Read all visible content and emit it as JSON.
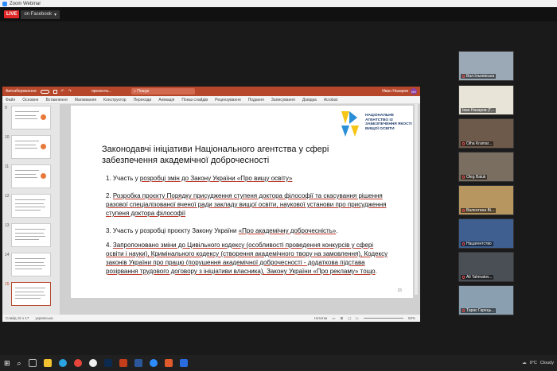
{
  "window": {
    "title": "Zoom Webinar"
  },
  "topbar": {
    "live_label": "LIVE",
    "stream_label": "on Facebook"
  },
  "ppt": {
    "autosave_label": "Автозбереження",
    "filename": "презента...",
    "search_placeholder": "Пошук",
    "user_name": "Иван Назаров",
    "user_initials": "ИН",
    "ribbon": [
      "Файл",
      "Основне",
      "Вставлення",
      "Малювання",
      "Конструктор",
      "Переходи",
      "Анімація",
      "Показ слайдів",
      "Рецензування",
      "Подання",
      "Записування",
      "Довідка",
      "Acrobat"
    ],
    "thumb_numbers": [
      "9",
      "10",
      "11",
      "12",
      "13",
      "14",
      "15"
    ],
    "status_left": "Слайд 15 з 17",
    "status_lang": "українська",
    "notes_label": "Нотатки",
    "zoom": "82%",
    "slide_number": "15"
  },
  "slide": {
    "logo_text": "НАЦІОНАЛЬНЕ АГЕНТСТВО ІЗ ЗАБЕЗПЕЧЕННЯ ЯКОСТІ ВИЩОЇ ОСВІТИ",
    "title": "Законодавчі ініціативи Національного агентства у сфері забезпечення академічної доброчесності",
    "item1_pre": "1. Участь у ",
    "item1_u": "розробці змін до Закону України «Про вищу освіту»",
    "item2_pre": "2. ",
    "item2_u": "Розробка проєкту Порядку присудження ступеня доктора філософії та скасування рішення разової спеціалізованої вченої ради закладу вищої освіти, наукової установи про присудження ступеня доктора філософії",
    "item3_pre": "3. Участь у розробці проєкту Закону України ",
    "item3_u": "«Про академічну доброчесність»",
    "item3_post": ".",
    "item4_pre": "4. ",
    "item4_u": "Запропоновано зміни до Цивільного кодексу (особливості проведення конкурсів у сфері освіти і науки), Кримінального кодексу (створення академічного твору на замовлення), Кодексу законів України про працю (порушення академічної доброчесності - додаткова підстава розірвання трудового договору з ініціативи власника), Закону України «Про рекламу» тощо",
    "item4_post": "."
  },
  "gallery": [
    {
      "name": "Вал.Ількевська",
      "bg": "#9aa9b5"
    },
    {
      "name": "Іван Назаров (Г...",
      "bg": "#e9e4d8"
    },
    {
      "name": "Olha Kramar...",
      "bg": "#6e5a4a"
    },
    {
      "name": "Oleg Baluk",
      "bg": "#7a6e60"
    },
    {
      "name": "Валентина Ві...",
      "bg": "#b89660"
    },
    {
      "name": "Нацагентство",
      "bg": "#3e5f8f"
    },
    {
      "name": "Ali Tahmatov...",
      "bg": "#4a4e55"
    },
    {
      "name": "Тарас Гарець...",
      "bg": "#8a9fb0"
    }
  ],
  "taskbar": {
    "temp": "9°C",
    "weather": "Cloudy"
  }
}
